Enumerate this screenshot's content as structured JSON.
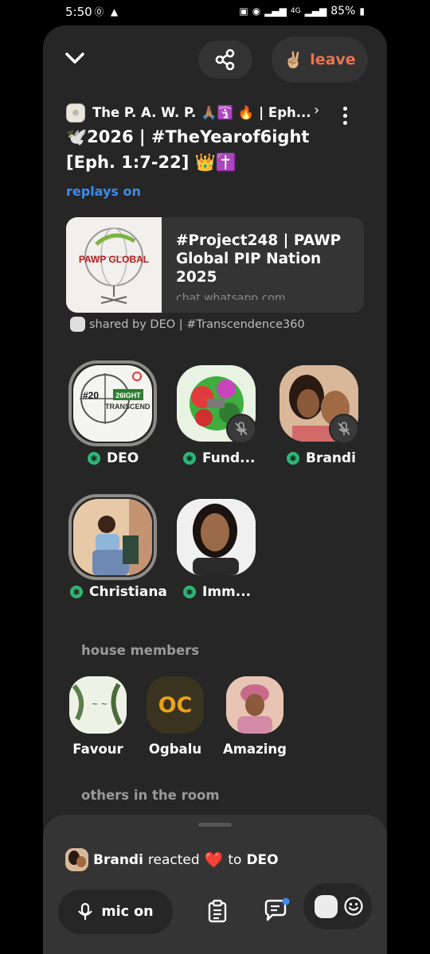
{
  "status_bar": {
    "time": "5:50",
    "network": "4G",
    "battery": "85%"
  },
  "top_bar": {
    "leave_emoji": "✌🏼",
    "leave_label": "leave"
  },
  "room": {
    "club_name": "The P. A. W. P. 🙏🏽🛐 🔥 | Eph...",
    "title": "🕊️2026 | #TheYearof6ight [Eph. 1:7-22] 👑✝️",
    "replays_label": "replays on"
  },
  "link_card": {
    "image_text": "PAWP GLOBAL",
    "title": "#Project248 | PAWP Global PIP Nation 2025",
    "url": "chat.whatsapp.com"
  },
  "shared_by": "shared by DEO | #Transcendence360",
  "speakers": [
    {
      "name": "DEO",
      "muted": false,
      "speaking": true
    },
    {
      "name": "Fund...",
      "muted": true,
      "speaking": false
    },
    {
      "name": "Brandi",
      "muted": true,
      "speaking": false
    },
    {
      "name": "Christiana",
      "muted": false,
      "speaking": true
    },
    {
      "name": "Imm...",
      "muted": false,
      "speaking": false
    }
  ],
  "speaker_icon_text": "✱",
  "deo_card": {
    "top": "#20",
    "badge": "26IGHT",
    "line": "TRANSCEND"
  },
  "house_members": {
    "label": "house members",
    "members": [
      {
        "name": "Favour"
      },
      {
        "name": "Ogbalu",
        "initials": "OC"
      },
      {
        "name": "Amazing"
      }
    ]
  },
  "others_label": "others in the room",
  "reaction": {
    "user": "Brandi",
    "verb": "reacted",
    "emoji": "❤️",
    "connector": "to",
    "target": "DEO"
  },
  "controls": {
    "mic_label": "mic on"
  },
  "colors": {
    "panel_bg": "#262626",
    "leave_accent": "#e8754f",
    "replays_blue": "#3d8be8",
    "speaking_green": "#2fb677"
  }
}
